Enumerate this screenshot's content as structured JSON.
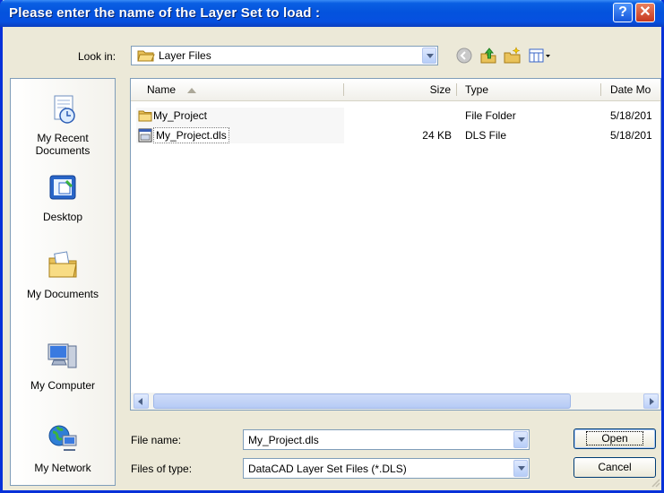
{
  "window": {
    "title": "Please enter the name of the Layer Set to load :",
    "help_glyph": "?",
    "close_glyph": "✕"
  },
  "lookin": {
    "label": "Look in:",
    "value": "Layer Files"
  },
  "toolbar": {
    "icons": [
      "back-icon",
      "up-folder-icon",
      "new-folder-icon",
      "views-menu-icon"
    ]
  },
  "places": [
    {
      "label": "My Recent Documents"
    },
    {
      "label": "Desktop"
    },
    {
      "label": "My Documents"
    },
    {
      "label": "My Computer"
    },
    {
      "label": "My Network"
    }
  ],
  "list": {
    "columns": {
      "name": "Name",
      "size": "Size",
      "type": "Type",
      "date": "Date Mo"
    },
    "rows": [
      {
        "name": "My_Project",
        "size": "",
        "type": "File Folder",
        "date": "5/18/201",
        "icon": "folder-icon"
      },
      {
        "name": "My_Project.dls",
        "size": "24 KB",
        "type": "DLS File",
        "date": "5/18/201",
        "icon": "dls-file-icon"
      }
    ]
  },
  "filename": {
    "label": "File name:",
    "value": "My_Project.dls"
  },
  "filetype": {
    "label": "Files of type:",
    "value": "DataCAD Layer Set Files (*.DLS)"
  },
  "buttons": {
    "open": "Open",
    "cancel": "Cancel"
  }
}
